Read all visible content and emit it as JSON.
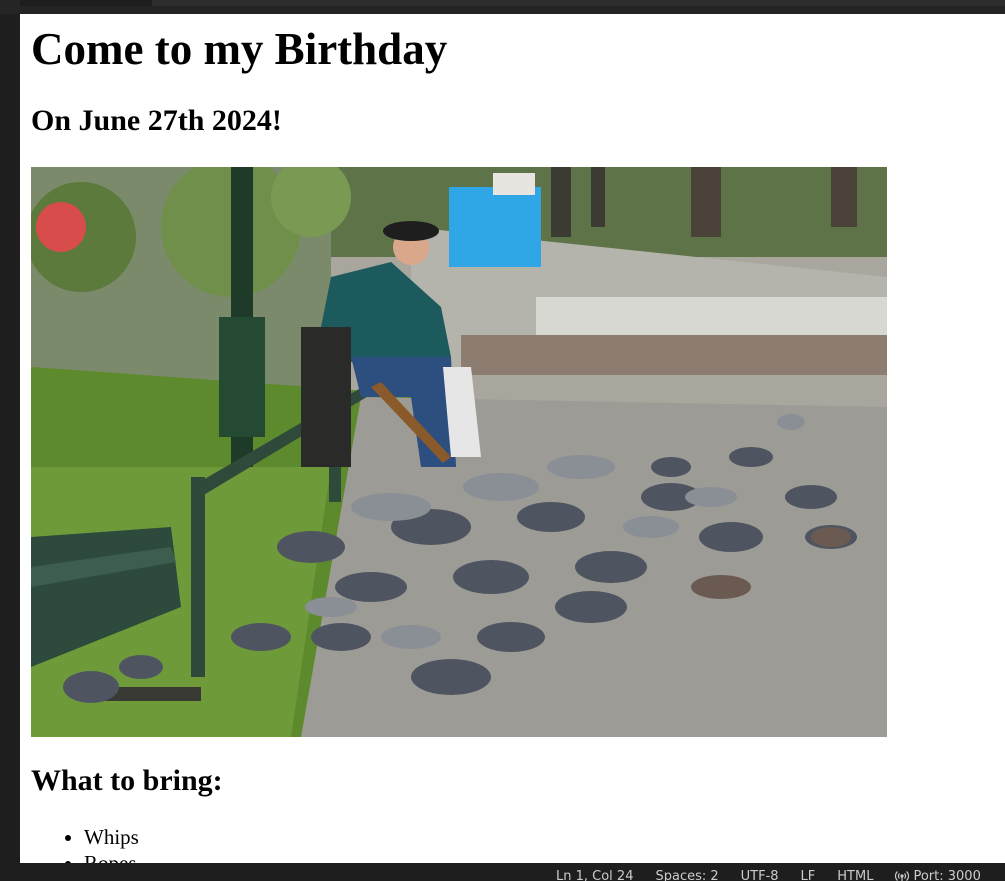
{
  "page": {
    "title": "Come to my Birthday",
    "date_heading": "On June 27th 2024!",
    "bring_heading": "What to bring:",
    "bring_items": [
      "Whips",
      "Ropes"
    ]
  },
  "photo": {
    "subject": "elderly man on park bench feeding a crowd of pigeons",
    "icon": "photo-image"
  },
  "statusbar": {
    "position": "Ln 1, Col 24",
    "spaces": "Spaces: 2",
    "encoding": "UTF-8",
    "eol": "LF",
    "language": "HTML",
    "port": "Port: 3000",
    "port_icon": "broadcast-icon"
  },
  "colors": {
    "editor_bg": "#1e1e1e",
    "preview_bg": "#ffffff",
    "status_text": "#cccccc"
  }
}
